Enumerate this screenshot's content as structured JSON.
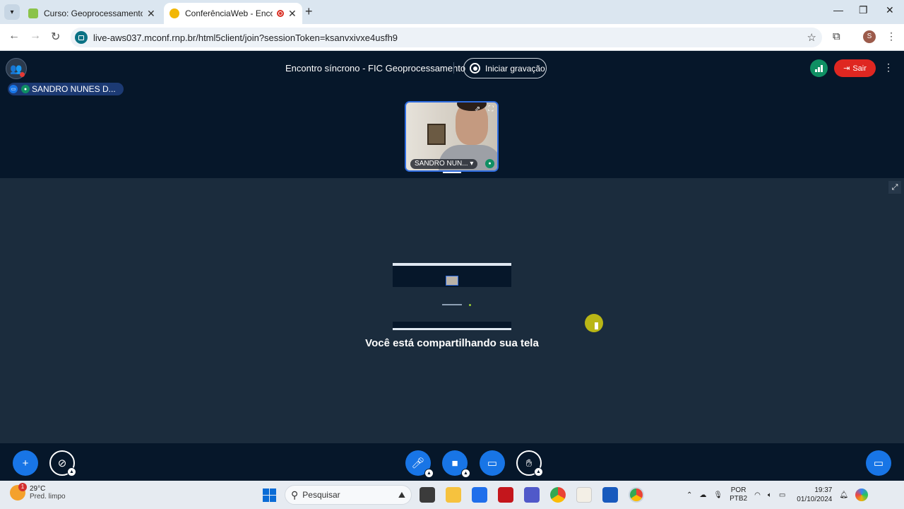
{
  "browser": {
    "tabs": [
      {
        "title": "Curso: Geoprocessamento básico",
        "favicon": "moodle-icon",
        "active": false
      },
      {
        "title": "ConferênciaWeb - Encontro",
        "favicon": "conferenciaweb-icon",
        "active": true,
        "recording": true
      }
    ],
    "new_tab_label": "+",
    "url": "live-aws037.mconf.rnp.br/html5client/join?sessionToken=ksanvxivxe4usfh9",
    "profile_initial": "S"
  },
  "header": {
    "meeting_title": "Encontro síncrono - FIC Geoprocessamento",
    "record_label": "Iniciar gravação",
    "leave_label": "Sair",
    "presenter_name": "SANDRO NUNES D..."
  },
  "webcam": {
    "name": "SANDRO NUN..."
  },
  "presentation": {
    "message": "Você está compartilhando sua tela"
  },
  "colors": {
    "app_bg": "#06172a",
    "stage_bg": "#1b2c3d",
    "primary": "#1875e6",
    "leave": "#df2721",
    "connection_good": "#0f8f63"
  },
  "taskbar": {
    "temperature": "29°C",
    "weather_text": "Pred. limpo",
    "weather_badge": "1",
    "search_placeholder": "Pesquisar",
    "lang_top": "POR",
    "lang_bottom": "PTB2",
    "time": "19:37",
    "date": "01/10/2024"
  }
}
